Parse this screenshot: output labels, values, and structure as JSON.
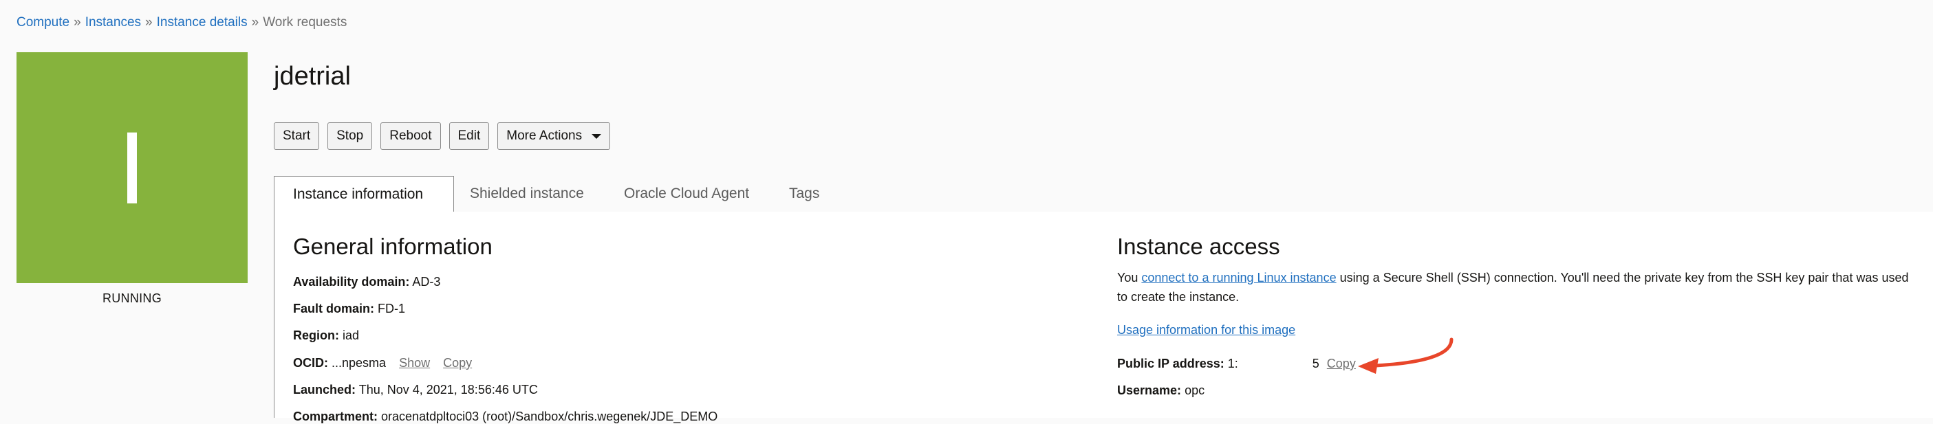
{
  "breadcrumb": {
    "items": [
      "Compute",
      "Instances",
      "Instance details"
    ],
    "current": "Work requests",
    "separator": "»"
  },
  "instance": {
    "tile_letter": "I",
    "tile_color": "#86b33d",
    "state": "RUNNING",
    "name": "jdetrial"
  },
  "actions": {
    "start": "Start",
    "stop": "Stop",
    "reboot": "Reboot",
    "edit": "Edit",
    "more": "More Actions"
  },
  "tabs": [
    {
      "label": "Instance information",
      "active": true
    },
    {
      "label": "Shielded instance",
      "active": false
    },
    {
      "label": "Oracle Cloud Agent",
      "active": false
    },
    {
      "label": "Tags",
      "active": false
    }
  ],
  "general": {
    "heading": "General information",
    "availability_label": "Availability domain:",
    "availability_value": "AD-3",
    "fault_label": "Fault domain:",
    "fault_value": "FD-1",
    "region_label": "Region:",
    "region_value": "iad",
    "ocid_label": "OCID:",
    "ocid_value": "...npesma",
    "ocid_show": "Show",
    "ocid_copy": "Copy",
    "launched_label": "Launched:",
    "launched_value": "Thu, Nov 4, 2021, 18:56:46 UTC",
    "compartment_label": "Compartment:",
    "compartment_value": "oracenatdpltoci03 (root)/Sandbox/chris.wegenek/JDE_DEMO"
  },
  "access": {
    "heading": "Instance access",
    "text_before": "You ",
    "link": "connect to a running Linux instance",
    "text_after": " using a Secure Shell (SSH) connection. You'll need the private key from the SSH key pair that was used to create the instance.",
    "usage_link": "Usage information for this image",
    "ip_label": "Public IP address:",
    "ip_prefix": "1:",
    "ip_suffix": "5",
    "ip_copy": "Copy",
    "username_label": "Username:",
    "username_value": "opc"
  },
  "colors": {
    "link": "#1f6fbf",
    "annotation_arrow": "#e8462a"
  }
}
